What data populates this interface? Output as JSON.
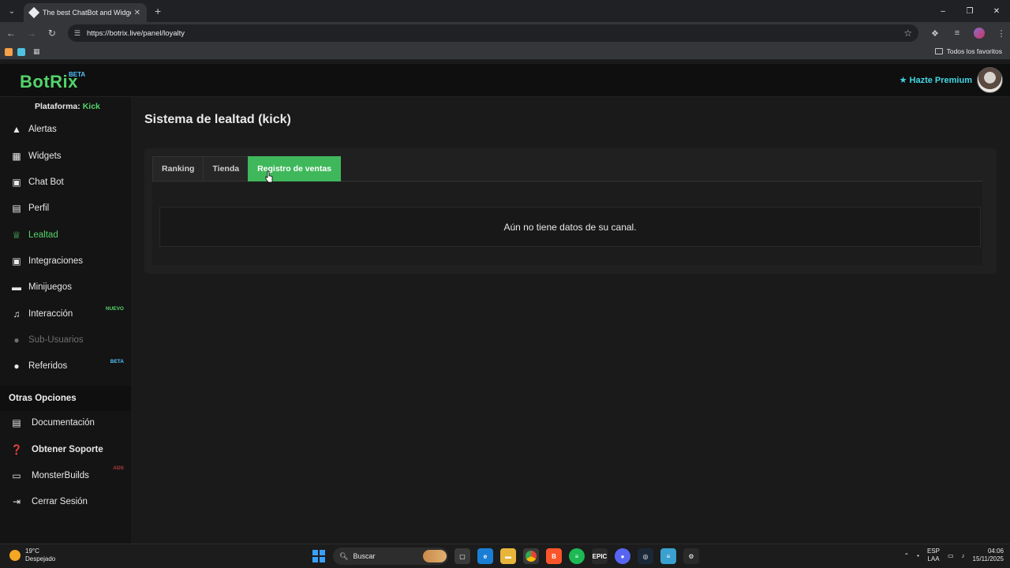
{
  "browser": {
    "tab_title": "The best ChatBot and Widgets",
    "url": "https://botrix.live/panel/loyalty",
    "all_bookmarks_label": "Todos los favoritos"
  },
  "header": {
    "logo": "BotRix",
    "logo_badge": "BETA",
    "premium_label": "Hazte Premium"
  },
  "sidebar": {
    "platform_label": "Plataforma:",
    "platform_value": "Kick",
    "items": [
      {
        "label": "Alertas",
        "icon": "warning-icon"
      },
      {
        "label": "Widgets",
        "icon": "widgets-icon"
      },
      {
        "label": "Chat Bot",
        "icon": "robot-icon"
      },
      {
        "label": "Perfil",
        "icon": "id-card-icon"
      },
      {
        "label": "Lealtad",
        "icon": "trophy-icon"
      },
      {
        "label": "Integraciones",
        "icon": "puzzle-icon"
      },
      {
        "label": "Minijuegos",
        "icon": "gamepad-icon"
      },
      {
        "label": "Interacción",
        "icon": "music-icon",
        "badge": "NUEVO"
      },
      {
        "label": "Sub-Usuarios",
        "icon": "users-icon"
      },
      {
        "label": "Referidos",
        "icon": "user-friends-icon",
        "badge": "BETA"
      }
    ],
    "other_title": "Otras Opciones",
    "other_items": [
      {
        "label": "Documentación",
        "icon": "book-icon"
      },
      {
        "label": "Obtener Soporte",
        "icon": "question-icon"
      },
      {
        "label": "MonsterBuilds",
        "icon": "laptop-icon",
        "badge": "ADS"
      },
      {
        "label": "Cerrar Sesión",
        "icon": "logout-icon"
      }
    ]
  },
  "main": {
    "title": "Sistema de lealtad (kick)",
    "tabs": [
      "Ranking",
      "Tienda",
      "Registro de ventas"
    ],
    "active_tab": "Registro de ventas",
    "empty_message": "Aún no tiene datos de su canal."
  },
  "taskbar": {
    "temperature": "19°C",
    "weather": "Despejado",
    "search_placeholder": "Buscar",
    "lang_top": "ESP",
    "lang_bottom": "LAA",
    "time": "04:06",
    "date": "15/11/2025"
  },
  "colors": {
    "accent": "#3fb85b",
    "brand_green": "#53d36a",
    "premium": "#43d6e4"
  }
}
